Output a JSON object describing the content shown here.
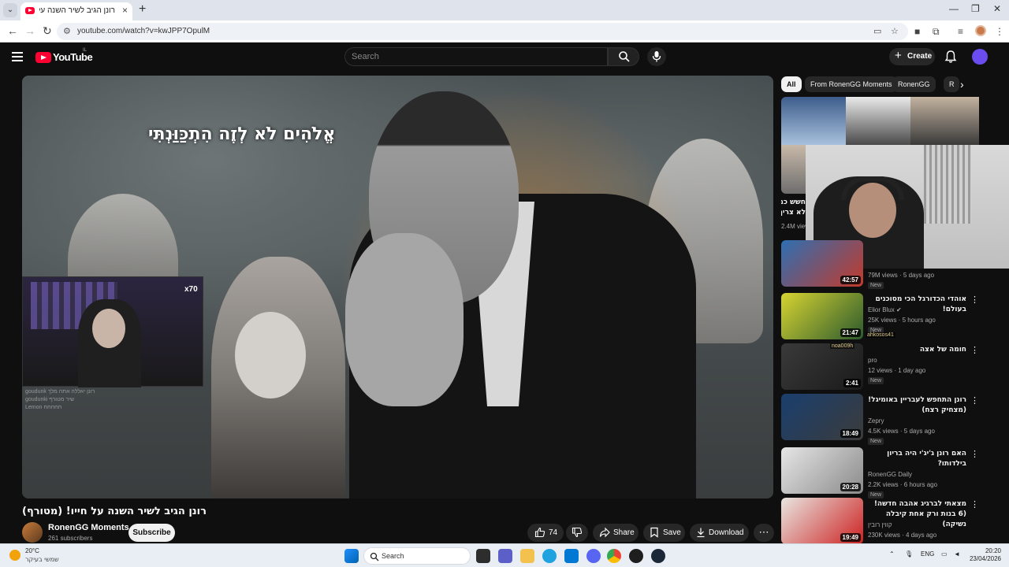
{
  "browser": {
    "tab_title": "רונן הגיב לשיר השנה על חייו! (מטורף) - YouTube",
    "url": "youtube.com/watch?v=kwJPP7OpulM",
    "new_tab": "+",
    "tab_close": "×",
    "window_controls": [
      "—",
      "❐",
      "✕"
    ]
  },
  "youtube": {
    "logo_text": "YouTube",
    "country_code": "IL",
    "search_placeholder": "Search",
    "create_label": "Create"
  },
  "player": {
    "caption": "אֱלֹהִים לֹא לְזֶה הִתְכַּוַּנְתִּי",
    "cam_badge": "x70",
    "chat_lines": [
      "goudunk  רונן יאללה אתה מלך",
      "goudunki  שיר מטורף",
      "Lemon  חחחחח"
    ]
  },
  "video": {
    "title": "רונן הגיב לשיר השנה על חייו! (מטורף)",
    "channel": "RonenGG Moments",
    "subscribers": "261 subscribers",
    "subscribe_label": "Subscribe",
    "likes": "74",
    "share_label": "Share",
    "save_label": "Save",
    "download_label": "Download"
  },
  "sidebar": {
    "chips": [
      "All",
      "From RonenGG Moments",
      "RonenGG",
      "R"
    ],
    "partial_item": {
      "title_1": "חשש כמה",
      "title_2": "לא צריך",
      "views": "2.4M views"
    },
    "items": [
      {
        "title": "",
        "channel": "",
        "meta": "79M views · 5 days ago",
        "badge": "New",
        "duration": "42:57",
        "thumb_a": "#2d6fb3",
        "thumb_b": "#c33a2a"
      },
      {
        "title": "אוהדי הכדורגל הכי מסוכנים בעולם!",
        "channel": "Elior Blux ✔",
        "meta": "25K views · 5 hours ago",
        "badge": "New",
        "duration": "21:47",
        "thumb_a": "#d7d431",
        "thumb_b": "#2c5a2e"
      },
      {
        "title": "חומה של אצה",
        "channel": "pro",
        "meta": "12 views · 1 day ago",
        "badge": "New",
        "duration": "2:41",
        "thumb_a": "#3a3a3a",
        "thumb_b": "#1a1a1a"
      },
      {
        "title": "רונן התחפש לעבריין באומיגל! (מצחיק רצח)",
        "channel": "Zepry",
        "meta": "4.5K views · 5 days ago",
        "badge": "New",
        "duration": "18:49",
        "thumb_a": "#1a3f6e",
        "thumb_b": "#3b3b3b"
      },
      {
        "title": "האם רונן ג'יג'י היה בריון בילדותו?",
        "channel": "RonenGG Daily",
        "meta": "2.2K views · 6 hours ago",
        "badge": "New",
        "duration": "20:28",
        "thumb_a": "#e6e6e6",
        "thumb_b": "#8a8a8a"
      },
      {
        "title": "מצאתי לברגיג אהבה חדשה! (6 בנות ורק אחת קיבלה נשיקה)",
        "channel": "קווין רובין",
        "meta": "230K views · 4 days ago",
        "badge": "",
        "duration": "19:49",
        "thumb_a": "#e9e6e1",
        "thumb_b": "#c22"
      }
    ],
    "overlay_labels": [
      "ahkosos41",
      "noa009h"
    ]
  },
  "taskbar": {
    "temp": "20°C",
    "weather_desc": "שמשי בעיקר",
    "search_label": "Search",
    "lang": "ENG",
    "time": "20:20",
    "date": "23/04/2026"
  }
}
